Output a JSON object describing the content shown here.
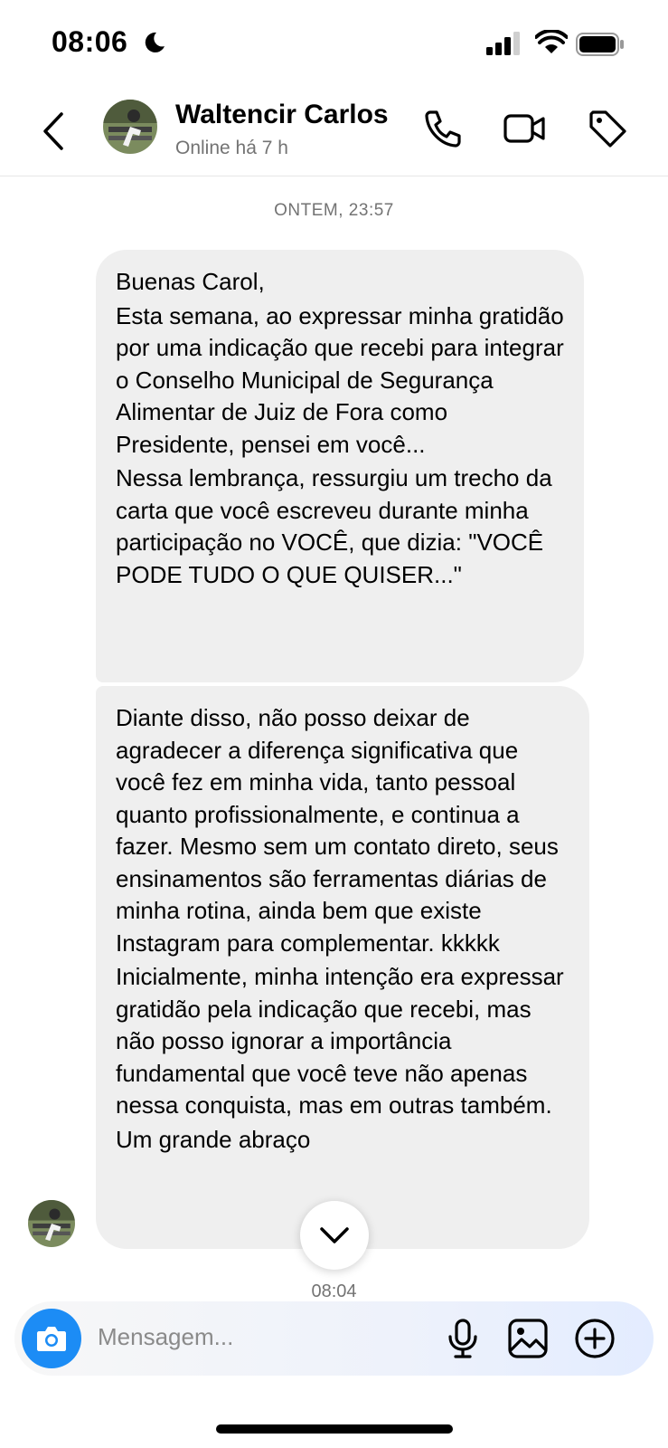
{
  "status_bar": {
    "time": "08:06"
  },
  "header": {
    "contact_name": "Waltencir Carlos",
    "presence": "Online há 7 h"
  },
  "thread": {
    "date_separator": "ONTEM, 23:57",
    "message_1": {
      "paragraphs": [
        "Buenas Carol,",
        "Esta semana, ao expressar minha gratidão por uma indicação que recebi para integrar o Conselho Municipal de Segurança Alimentar de Juiz de Fora como Presidente, pensei em você...",
        "Nessa lembrança, ressurgiu um trecho da carta que você escreveu durante minha participação no VOCÊ, que dizia: \"VOCÊ PODE TUDO O QUE QUISER...\""
      ]
    },
    "message_2": {
      "paragraphs": [
        "Diante disso, não posso deixar de agradecer a diferença significativa que você fez em minha vida, tanto pessoal quanto profissionalmente, e continua a fazer. Mesmo sem um contato direto, seus ensinamentos são ferramentas diárias de minha rotina, ainda bem que existe Instagram para complementar. kkkkk",
        "Inicialmente, minha intenção era expressar gratidão pela indicação que recebi, mas não posso ignorar a importância fundamental que você teve não apenas nessa conquista, mas em outras também.",
        "Um grande abraço"
      ]
    },
    "message_time": "08:04"
  },
  "composer": {
    "placeholder": "Mensagem..."
  },
  "icons": {
    "status": [
      "moon-icon",
      "signal-icon",
      "wifi-icon",
      "battery-icon"
    ],
    "header": [
      "back-icon",
      "phone-icon",
      "video-icon",
      "tag-icon"
    ],
    "composer": [
      "camera-icon",
      "microphone-icon",
      "gallery-icon",
      "plus-icon"
    ],
    "thread": [
      "chevron-down-icon"
    ]
  },
  "colors": {
    "accent": "#1c8cf5",
    "bubble": "#efefef",
    "muted_text": "#737373"
  }
}
